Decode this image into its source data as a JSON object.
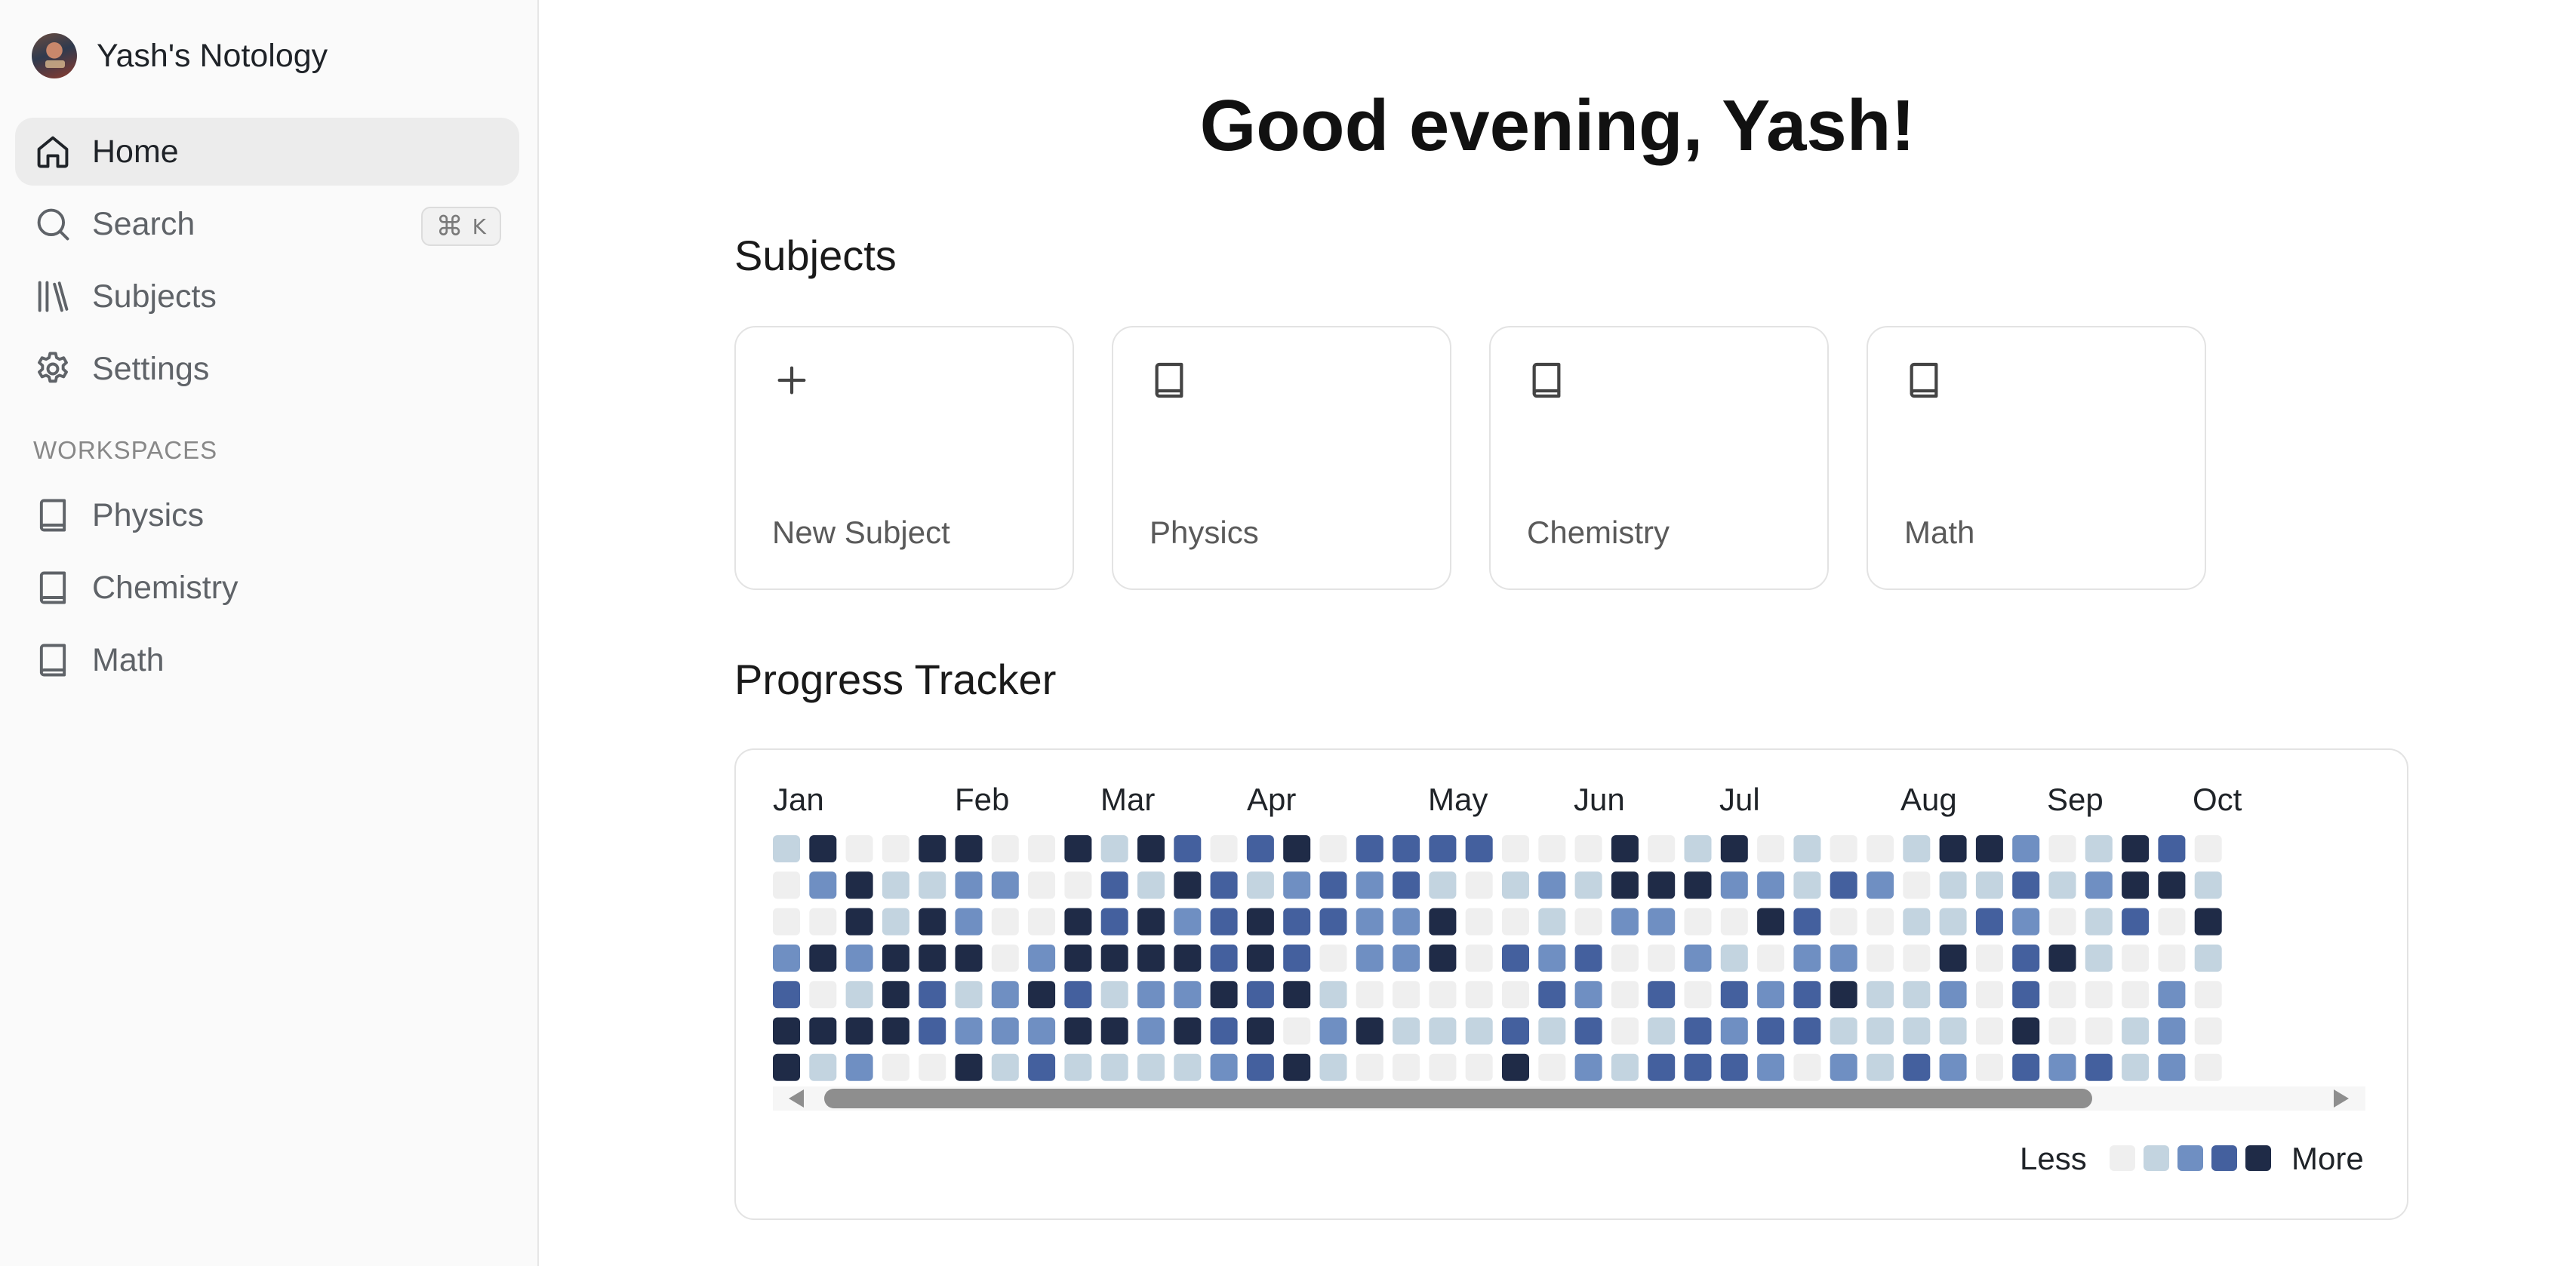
{
  "sidebar": {
    "workspace_name": "Yash's Notology",
    "nav": [
      {
        "label": "Home",
        "icon": "home-icon",
        "active": true
      },
      {
        "label": "Search",
        "icon": "search-icon",
        "shortcut": {
          "symbol": "⌘",
          "key": "K"
        }
      },
      {
        "label": "Subjects",
        "icon": "library-icon"
      },
      {
        "label": "Settings",
        "icon": "gear-icon"
      }
    ],
    "workspaces_label": "WORKSPACES",
    "workspaces": [
      {
        "label": "Physics",
        "icon": "book-icon"
      },
      {
        "label": "Chemistry",
        "icon": "book-icon"
      },
      {
        "label": "Math",
        "icon": "book-icon"
      }
    ]
  },
  "main": {
    "greeting": "Good evening, Yash!",
    "subjects_title": "Subjects",
    "subject_cards": [
      {
        "label": "New Subject",
        "icon": "plus-icon"
      },
      {
        "label": "Physics",
        "icon": "book-icon"
      },
      {
        "label": "Chemistry",
        "icon": "book-icon"
      },
      {
        "label": "Math",
        "icon": "book-icon"
      }
    ],
    "progress_title": "Progress Tracker",
    "tracker": {
      "months": [
        "Jan",
        "Feb",
        "Mar",
        "Apr",
        "May",
        "Jun",
        "Jul",
        "Aug",
        "Sep",
        "Oct"
      ],
      "legend_less": "Less",
      "legend_more": "More",
      "level_colors": [
        "#efefef",
        "#c3d4e0",
        "#6f8fc2",
        "#44609e",
        "#1f2b47"
      ],
      "rows": [
        "1400440041430340333300040140100144201430",
        "0241122003143123231012144422132011312441",
        "0041420043423433224001022004300113201304",
        "2424440244443430224032300210220040341001",
        "3014312431224341000003203032341120300020",
        "4444322244243402411131301323311110400120",
        "4120041311112341000040213332021320323120"
      ]
    }
  },
  "colors": {
    "sidebar_bg": "#fafafa",
    "active_item_bg": "#ececec"
  }
}
